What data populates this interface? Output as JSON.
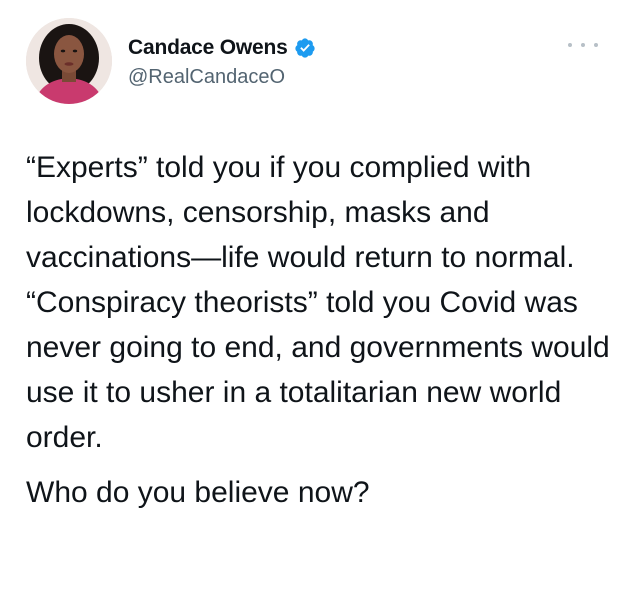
{
  "author": {
    "name": "Candace Owens",
    "handle": "@RealCandaceO",
    "verified": true,
    "verified_color": "#1d9bf0"
  },
  "icons": {
    "avatar": "profile-photo",
    "verified": "verified-badge-icon",
    "more": "more-dots-icon"
  },
  "tweet": {
    "paragraphs": [
      "“Experts” told you if you complied with lockdowns, censorship, masks and vaccinations—life would return to normal.",
      "“Conspiracy theorists” told you Covid was never going to end, and governments would use it to usher in a totalitarian new world order.",
      "Who do you believe now?"
    ]
  }
}
